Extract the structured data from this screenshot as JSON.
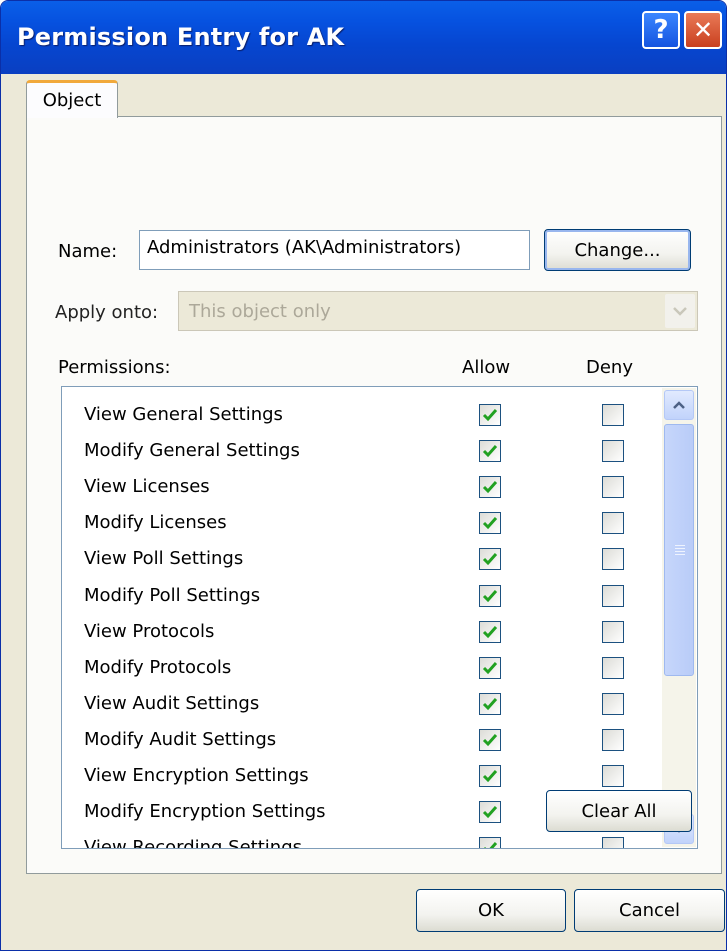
{
  "window": {
    "title": "Permission Entry for AK",
    "help_glyph": "?",
    "close_glyph": "✕"
  },
  "tabs": [
    {
      "label": "Object",
      "active": true
    }
  ],
  "name_field": {
    "label": "Name:",
    "value": "Administrators (AK\\Administrators)"
  },
  "change_button": {
    "label": "Change..."
  },
  "apply_onto": {
    "label": "Apply onto:",
    "value": "This object only",
    "disabled": true
  },
  "permissions": {
    "header_label": "Permissions:",
    "allow_label": "Allow",
    "deny_label": "Deny",
    "rows": [
      {
        "label": "View General Settings",
        "allow": true,
        "deny": false
      },
      {
        "label": "Modify General Settings",
        "allow": true,
        "deny": false
      },
      {
        "label": "View Licenses",
        "allow": true,
        "deny": false
      },
      {
        "label": "Modify Licenses",
        "allow": true,
        "deny": false
      },
      {
        "label": "View Poll Settings",
        "allow": true,
        "deny": false
      },
      {
        "label": "Modify Poll Settings",
        "allow": true,
        "deny": false
      },
      {
        "label": "View Protocols",
        "allow": true,
        "deny": false
      },
      {
        "label": "Modify Protocols",
        "allow": true,
        "deny": false
      },
      {
        "label": "View Audit Settings",
        "allow": true,
        "deny": false
      },
      {
        "label": "Modify Audit Settings",
        "allow": true,
        "deny": false
      },
      {
        "label": "View Encryption Settings",
        "allow": true,
        "deny": false
      },
      {
        "label": "Modify Encryption Settings",
        "allow": true,
        "deny": false
      },
      {
        "label": "View Recording Settings",
        "allow": true,
        "deny": false
      }
    ]
  },
  "clear_all_button": {
    "label": "Clear All"
  },
  "ok_button": {
    "label": "OK"
  },
  "cancel_button": {
    "label": "Cancel"
  },
  "colors": {
    "titlebar": "#0651df",
    "dialog_bg": "#ece9d8",
    "check": "#21a121",
    "tab_accent": "#f1a93b"
  }
}
